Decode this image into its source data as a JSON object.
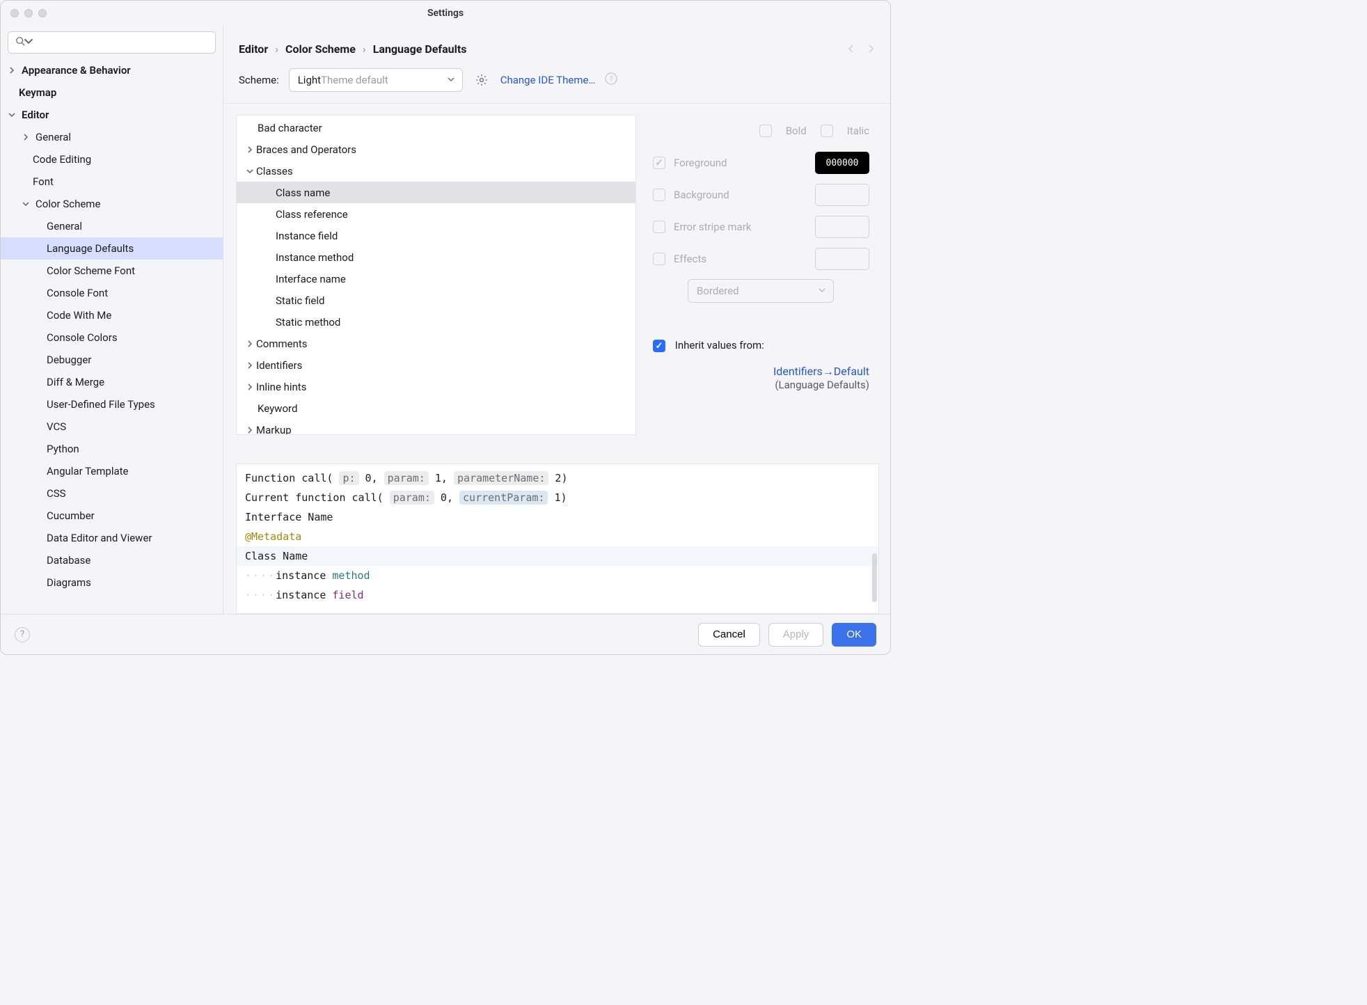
{
  "title": "Settings",
  "search_placeholder": "",
  "sidebar": [
    {
      "label": "Appearance & Behavior",
      "level": 0,
      "chev": "right"
    },
    {
      "label": "Keymap",
      "level": 0
    },
    {
      "label": "Editor",
      "level": 0,
      "chev": "down"
    },
    {
      "label": "General",
      "level": 1,
      "chev": "right"
    },
    {
      "label": "Code Editing",
      "level": 1
    },
    {
      "label": "Font",
      "level": 1
    },
    {
      "label": "Color Scheme",
      "level": 1,
      "chev": "down"
    },
    {
      "label": "General",
      "level": 2
    },
    {
      "label": "Language Defaults",
      "level": 2,
      "selected": true
    },
    {
      "label": "Color Scheme Font",
      "level": 2
    },
    {
      "label": "Console Font",
      "level": 2
    },
    {
      "label": "Code With Me",
      "level": 2
    },
    {
      "label": "Console Colors",
      "level": 2
    },
    {
      "label": "Debugger",
      "level": 2
    },
    {
      "label": "Diff & Merge",
      "level": 2
    },
    {
      "label": "User-Defined File Types",
      "level": 2
    },
    {
      "label": "VCS",
      "level": 2
    },
    {
      "label": "Python",
      "level": 2
    },
    {
      "label": "Angular Template",
      "level": 2
    },
    {
      "label": "CSS",
      "level": 2
    },
    {
      "label": "Cucumber",
      "level": 2
    },
    {
      "label": "Data Editor and Viewer",
      "level": 2
    },
    {
      "label": "Database",
      "level": 2
    },
    {
      "label": "Diagrams",
      "level": 2
    }
  ],
  "breadcrumb": [
    "Editor",
    "Color Scheme",
    "Language Defaults"
  ],
  "scheme": {
    "label": "Scheme:",
    "value_main": "Light",
    "value_rest": " Theme default",
    "change_link": "Change IDE Theme…"
  },
  "tokens": [
    {
      "label": "Bad character",
      "level": 0
    },
    {
      "label": "Braces and Operators",
      "level": 0,
      "chev": "right"
    },
    {
      "label": "Classes",
      "level": 0,
      "chev": "down"
    },
    {
      "label": "Class name",
      "level": 1,
      "selected": true
    },
    {
      "label": "Class reference",
      "level": 1
    },
    {
      "label": "Instance field",
      "level": 1
    },
    {
      "label": "Instance method",
      "level": 1
    },
    {
      "label": "Interface name",
      "level": 1
    },
    {
      "label": "Static field",
      "level": 1
    },
    {
      "label": "Static method",
      "level": 1
    },
    {
      "label": "Comments",
      "level": 0,
      "chev": "right"
    },
    {
      "label": "Identifiers",
      "level": 0,
      "chev": "right"
    },
    {
      "label": "Inline hints",
      "level": 0,
      "chev": "right"
    },
    {
      "label": "Keyword",
      "level": 0
    },
    {
      "label": "Markup",
      "level": 0,
      "chev": "right"
    }
  ],
  "props": {
    "bold": "Bold",
    "italic": "Italic",
    "foreground": "Foreground",
    "fg_value": "000000",
    "background": "Background",
    "error_stripe": "Error stripe mark",
    "effects": "Effects",
    "effect_kind": "Bordered",
    "inherit_label": "Inherit values from:",
    "inherit_link": "Identifiers→Default",
    "inherit_sub": "(Language Defaults)"
  },
  "preview": {
    "fncall_1": "Function call(",
    "hint_p": "p:",
    "zero": " 0, ",
    "hint_param": "param:",
    "one_comma": " 1, ",
    "hint_pname": "parameterName:",
    "two_paren": " 2)",
    "curcall": "Current function call(",
    "hint_param2": "param:",
    "zero_comma": " 0, ",
    "hint_cur": "currentParam:",
    "one_paren": " 1)",
    "iface": "Interface Name",
    "metadata": "@Metadata",
    "classname": "Class Name",
    "inst_m_pre": "    instance ",
    "method": "method",
    "inst_f_pre": "    instance ",
    "field": "field"
  },
  "footer": {
    "cancel": "Cancel",
    "apply": "Apply",
    "ok": "OK"
  }
}
